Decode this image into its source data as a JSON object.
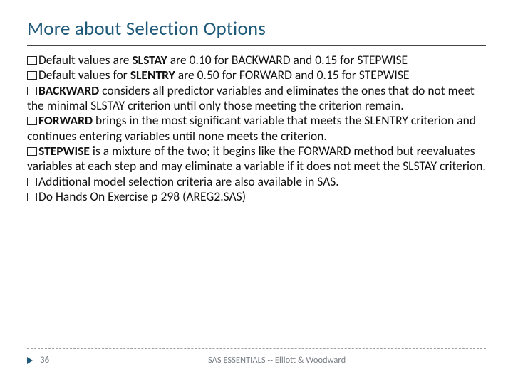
{
  "title": "More about Selection Options",
  "items": [
    {
      "pre": "Default values are ",
      "bold1": "SLSTAY",
      "mid": " are  0.10 for BACKWARD and 0.15 for STEPWISE"
    },
    {
      "pre": "Default values for ",
      "bold1": "SLENTRY",
      "mid": " are 0.50 for FORWARD and 0.15 for STEPWISE"
    },
    {
      "bold1": "BACKWARD",
      "mid": " considers all predictor variables and eliminates the ones that do not meet the minimal SLSTAY criterion until only those meeting the criterion remain."
    },
    {
      "bold1": "FORWARD",
      "mid": " brings in the most significant variable that meets the SLENTRY criterion and continues entering variables until none meets the criterion."
    },
    {
      "bold1": "STEPWISE",
      "mid": " is a mixture of the two; it begins like the FORWARD method but reevaluates variables at each step and may eliminate a variable if it does not meet the SLSTAY criterion."
    },
    {
      "pre": "Additional model selection criteria are also available in SAS."
    },
    {
      "pre": "Do Hands On Exercise p 298 (AREG2.SAS)"
    }
  ],
  "page_number": "36",
  "footer_text": "SAS ESSENTIALS -- Elliott & Woodward"
}
